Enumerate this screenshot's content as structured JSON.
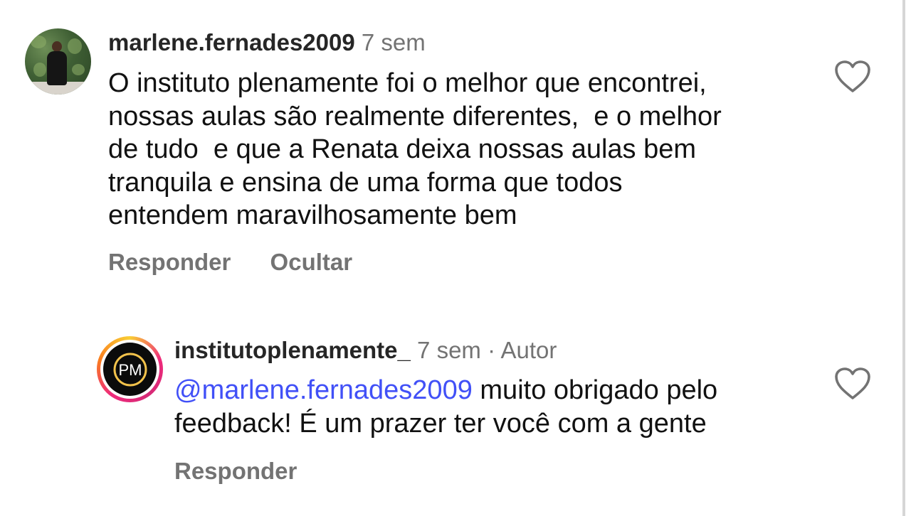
{
  "comment": {
    "username": "marlene.fernades2009",
    "time": "7 sem",
    "text_lines": [
      "O instituto plenamente foi o melhor que encontrei,",
      "nossas aulas são realmente diferentes,  e o melhor",
      "de tudo  e que a Renata deixa nossas aulas bem",
      "tranquila e ensina de uma forma que todos",
      "entendem maravilhosamente bem"
    ],
    "reply_label": "Responder",
    "hide_label": "Ocultar",
    "like_icon": "heart-outline-icon"
  },
  "reply": {
    "username": "institutoplenamente_",
    "time": "7 sem",
    "separator": "·",
    "author_badge": "Autor",
    "mention": "@marlene.fernades2009",
    "text_line1_rest": " muito obrigado pelo",
    "text_line2": "feedback! É um prazer ter você com a gente",
    "reply_label": "Responder",
    "like_icon": "heart-outline-icon",
    "avatar_logo_text": "PM"
  },
  "colors": {
    "mention": "#4150f7",
    "meta": "#737373",
    "story_ring": [
      "#f9ce34",
      "#ee2a7b",
      "#fa7e1e"
    ]
  }
}
